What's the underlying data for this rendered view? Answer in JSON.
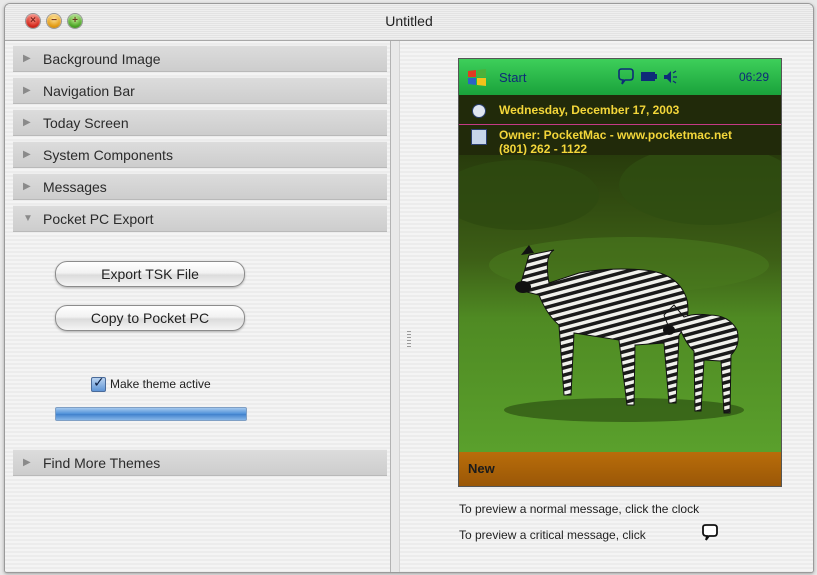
{
  "window": {
    "title": "Untitled"
  },
  "sections": [
    {
      "label": "Background Image",
      "expanded": false
    },
    {
      "label": "Navigation Bar",
      "expanded": false
    },
    {
      "label": "Today Screen",
      "expanded": false
    },
    {
      "label": "System Components",
      "expanded": false
    },
    {
      "label": "Messages",
      "expanded": false
    },
    {
      "label": "Pocket PC Export",
      "expanded": true
    },
    {
      "label": "Find More Themes",
      "expanded": false
    }
  ],
  "export": {
    "export_tsk_label": "Export TSK File",
    "copy_label": "Copy to Pocket PC",
    "make_active_label": "Make theme active",
    "make_active_checked": true,
    "progress_fraction": 1.0
  },
  "preview": {
    "start_label": "Start",
    "clock": "06:29",
    "date_line": "Wednesday, December 17, 2003",
    "owner_line": "Owner: PocketMac - www.pocketmac.net",
    "owner_phone": "(801) 262 - 1122",
    "new_label": "New",
    "nav_bar_color": "#1fb043",
    "menu_bar_color": "#a9600a",
    "today_text_color": "#f3d63a"
  },
  "hints": {
    "normal": "To preview a normal message, click the clock",
    "critical": "To preview a critical message, click"
  },
  "icons": [
    "close-button",
    "minimize-button",
    "zoom-button",
    "disclosure-triangle-icon",
    "windows-flag-icon",
    "message-bubble-icon",
    "battery-icon",
    "speaker-icon",
    "clock-icon",
    "owner-card-icon",
    "splitter-grip-icon"
  ]
}
